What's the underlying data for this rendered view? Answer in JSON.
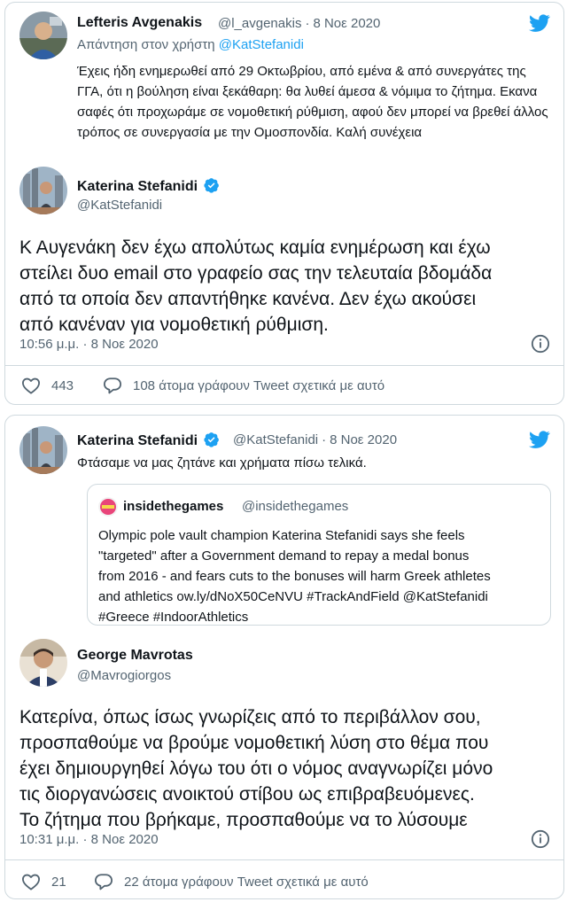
{
  "tweet1": {
    "parent": {
      "name": "Lefteris Avgenakis",
      "handle": "@l_avgenakis",
      "date": "8 Νοε 2020",
      "reply_label": "Απάντηση στον χρήστη",
      "reply_mention": "@KatStefanidi",
      "text": "Έχεις ήδη ενημερωθεί από 29 Οκτωβρίου, από εμένα & από συνεργάτες της ΓΓΑ, ότι η βούληση είναι ξεκάθαρη: θα λυθεί άμεσα & νόμιμα το ζήτημα. Εκανα σαφές ότι προχωράμε σε νομοθετική ρύθμιση, αφού δεν μπορεί να βρεθεί άλλος τρόπος σε συνεργασία με την Ομοσπονδία. Καλή συνέχεια"
    },
    "main": {
      "name": "Katerina Stefanidi",
      "handle": "@KatStefanidi",
      "text": "Κ Αυγενάκη δεν έχω απολύτως καμία ενημέρωση και έχω\nστείλει δυο email στο γραφείο σας την τελευταία βδομάδα\nαπό τα οποία δεν απαντήθηκε κανένα. Δεν έχω ακούσει\nαπό κανέναν για νομοθετική ρύθμιση.",
      "timestamp": "10:56 μ.μ. · 8 Νοε 2020",
      "likes": "443",
      "comment_label": "108 άτομα γράφουν Tweet σχετικά με αυτό"
    }
  },
  "tweet2": {
    "parent": {
      "name": "Katerina Stefanidi",
      "handle": "@KatStefanidi",
      "date": "8 Νοε 2020",
      "text": "Φτάσαμε να μας ζητάνε και χρήματα πίσω τελικά.",
      "quote": {
        "name": "insidethegames",
        "handle": "@insidethegames",
        "text": "Olympic pole vault champion Katerina Stefanidi says she feels\n\"targeted\" after a Government demand to repay a medal bonus\nfrom 2016 - and fears cuts to the bonuses will harm Greek athletes\nand athletics ow.ly/dNoX50CeNVU #TrackAndField @KatStefanidi\n#Greece #IndoorAthletics"
      }
    },
    "main": {
      "name": "George Mavrotas",
      "handle": "@Mavrogiorgos",
      "text": "Κατερίνα, όπως ίσως γνωρίζεις από το περιβάλλον σου,\nπροσπαθούμε να βρούμε νομοθετική λύση στο θέμα που\nέχει δημιουργηθεί λόγω του ότι ο νόμος αναγνωρίζει μόνο\nτις διοργανώσεις ανοικτού στίβου ως επιβραβευόμενες.\nΤο ζήτημα που βρήκαμε, προσπαθούμε να το λύσουμε",
      "timestamp": "10:31 μ.μ. · 8 Νοε 2020",
      "likes": "21",
      "comment_label": "22 άτομα γράφουν Tweet σχετικά με αυτό"
    }
  },
  "colors": {
    "accent": "#1da1f2",
    "text": "#0f1419",
    "muted": "#536471",
    "border": "#cfd9de"
  },
  "icons": [
    "twitter-bird-icon",
    "verified-badge-icon",
    "heart-icon",
    "comment-icon",
    "info-icon"
  ]
}
